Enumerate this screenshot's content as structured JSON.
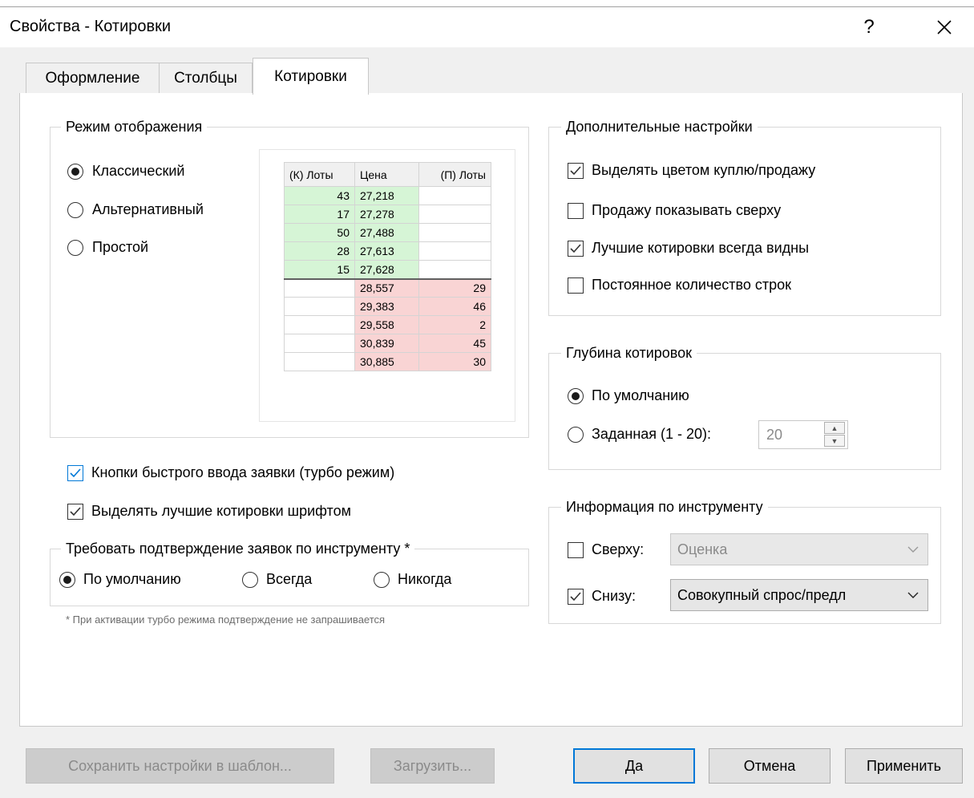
{
  "window": {
    "title": "Свойства - Котировки",
    "help_label": "?",
    "close_label": "✕"
  },
  "tabs": [
    {
      "label": "Оформление",
      "active": false
    },
    {
      "label": "Столбцы",
      "active": false
    },
    {
      "label": "Котировки",
      "active": true
    }
  ],
  "display_mode": {
    "title": "Режим отображения",
    "options": [
      {
        "label": "Классический",
        "selected": true
      },
      {
        "label": "Альтернативный",
        "selected": false
      },
      {
        "label": "Простой",
        "selected": false
      }
    ],
    "preview": {
      "headers": [
        "(К) Лоты",
        "Цена",
        "(П) Лоты"
      ],
      "buy_rows": [
        {
          "lots": "43",
          "price": "27,218"
        },
        {
          "lots": "17",
          "price": "27,278"
        },
        {
          "lots": "50",
          "price": "27,488"
        },
        {
          "lots": "28",
          "price": "27,613"
        },
        {
          "lots": "15",
          "price": "27,628"
        }
      ],
      "sell_rows": [
        {
          "price": "28,557",
          "lots": "29"
        },
        {
          "price": "29,383",
          "lots": "46"
        },
        {
          "price": "29,558",
          "lots": "2"
        },
        {
          "price": "30,839",
          "lots": "45"
        },
        {
          "price": "30,885",
          "lots": "30"
        }
      ]
    }
  },
  "turbo_checkbox": {
    "label": "Кнопки быстрого ввода заявки (турбо режим)",
    "checked": true
  },
  "best_font_checkbox": {
    "label": "Выделять лучшие котировки шрифтом",
    "checked": true
  },
  "confirm_group": {
    "title": "Требовать подтверждение заявок по инструменту *",
    "options": [
      {
        "label": "По умолчанию",
        "selected": true
      },
      {
        "label": "Всегда",
        "selected": false
      },
      {
        "label": "Никогда",
        "selected": false
      }
    ]
  },
  "footnote": "* При активации турбо режима подтверждение не запрашивается",
  "extra_settings": {
    "title": "Дополнительные настройки",
    "items": [
      {
        "label": "Выделять цветом куплю/продажу",
        "checked": true
      },
      {
        "label": "Продажу показывать сверху",
        "checked": false
      },
      {
        "label": "Лучшие котировки всегда видны",
        "checked": true
      },
      {
        "label": "Постоянное количество строк",
        "checked": false
      }
    ]
  },
  "depth": {
    "title": "Глубина котировок",
    "default_label": "По умолчанию",
    "custom_label": "Заданная (1 - 20):",
    "default_selected": true,
    "value": "20"
  },
  "instrument_info": {
    "title": "Информация по инструменту",
    "top": {
      "label": "Сверху:",
      "checked": false,
      "value": "Оценка"
    },
    "bottom": {
      "label": "Снизу:",
      "checked": true,
      "value": "Совокупный спрос/предл"
    }
  },
  "buttons": {
    "save_template": "Сохранить настройки в шаблон...",
    "load": "Загрузить...",
    "ok": "Да",
    "cancel": "Отмена",
    "apply": "Применить"
  },
  "colors": {
    "buy": "#d6f5d6",
    "sell": "#f9d4d4",
    "accent": "#0078d7"
  }
}
